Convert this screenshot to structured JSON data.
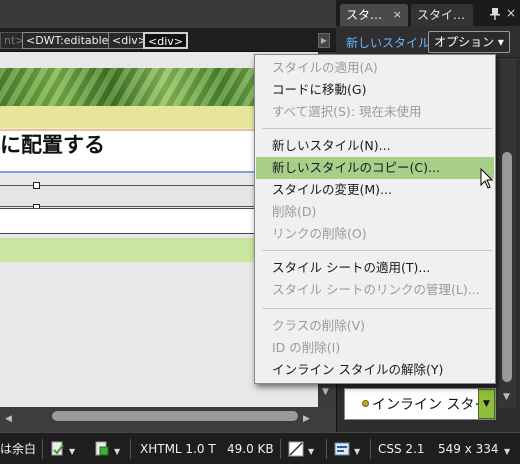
{
  "tag_bar": {
    "items": [
      "nt>",
      "<DWT:editable>",
      "<div>",
      "<div>"
    ]
  },
  "document": {
    "heading_text": "に配置する"
  },
  "panel": {
    "tabs": [
      "スタ…",
      "スタイ…"
    ],
    "close_glyph": "×",
    "new_style_link": "新しいスタイル…",
    "options_button": "オプション ▾",
    "inline_style_label": "インライン スタイ"
  },
  "context_menu": {
    "items": [
      {
        "label": "スタイルの適用(A)",
        "enabled": false
      },
      {
        "label": "コードに移動(G)",
        "enabled": true
      },
      {
        "label": "すべて選択(S): 現在未使用",
        "enabled": false
      },
      {
        "label": "新しいスタイル(N)...",
        "enabled": true
      },
      {
        "label": "新しいスタイルのコピー(C)...",
        "enabled": true,
        "highlighted": true
      },
      {
        "label": "スタイルの変更(M)...",
        "enabled": true
      },
      {
        "label": "削除(D)",
        "enabled": false
      },
      {
        "label": "リンクの削除(O)",
        "enabled": false
      },
      {
        "label": "スタイル シートの適用(T)...",
        "enabled": true
      },
      {
        "label": "スタイル シートのリンクの管理(L)...",
        "enabled": false
      },
      {
        "label": "クラスの削除(V)",
        "enabled": false
      },
      {
        "label": "ID の削除(I)",
        "enabled": false
      },
      {
        "label": "インライン スタイルの解除(Y)",
        "enabled": true
      }
    ]
  },
  "status_bar": {
    "left_text": "は余白",
    "doctype": "XHTML 1.0 T",
    "file_size": "49.0 KB",
    "css_version": "CSS 2.1",
    "dimensions": "549 x 334"
  },
  "colors": {
    "menu_highlight": "#a8cf8a",
    "link_blue": "#69b4ff",
    "inline_dropdown_green": "#8ebf3a"
  }
}
